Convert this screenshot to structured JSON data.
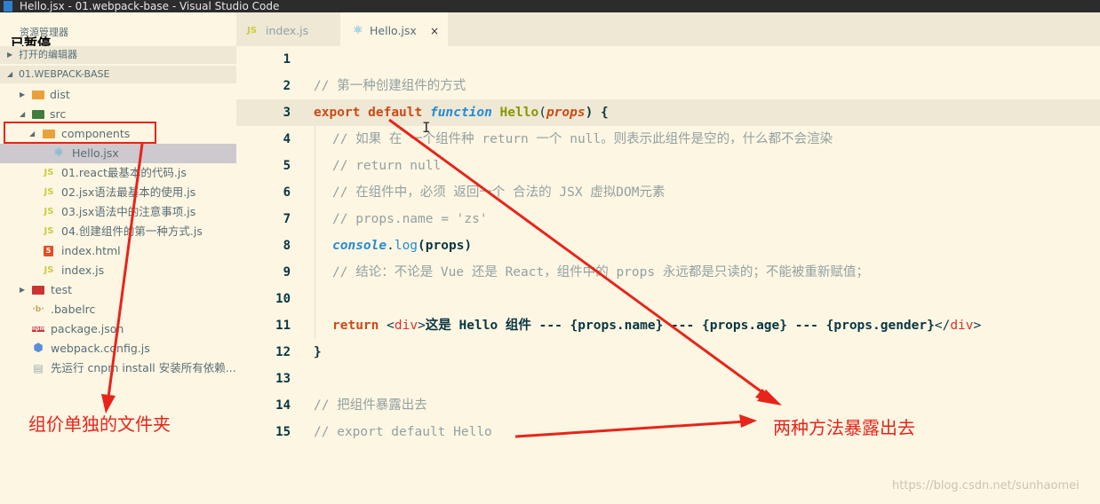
{
  "window": {
    "title": "Hello.jsx - 01.webpack-base - Visual Studio Code"
  },
  "sidebar": {
    "header": "资源管理器",
    "paused_label": "已暂停",
    "open_editors": "打开的编辑器",
    "project": "01.WEBPACK-BASE",
    "tree": [
      {
        "name": "dist",
        "icon": "folder-icon",
        "twisty": "collapsed"
      },
      {
        "name": "src",
        "icon": "folder-green-icon",
        "twisty": "expanded"
      },
      {
        "name": "components",
        "icon": "folder-open-icon",
        "twisty": "expanded"
      },
      {
        "name": "Hello.jsx",
        "icon": "react-icon"
      },
      {
        "name": "01.react最基本的代码.js",
        "icon": "js-icon"
      },
      {
        "name": "02.jsx语法最基本的使用.js",
        "icon": "js-icon"
      },
      {
        "name": "03.jsx语法中的注意事项.js",
        "icon": "js-icon"
      },
      {
        "name": "04.创建组件的第一种方式.js",
        "icon": "js-icon"
      },
      {
        "name": "index.html",
        "icon": "html-icon"
      },
      {
        "name": "index.js",
        "icon": "js-icon"
      },
      {
        "name": "test",
        "icon": "folder-red-icon",
        "twisty": "collapsed"
      },
      {
        "name": ".babelrc",
        "icon": "babel-icon"
      },
      {
        "name": "package.json",
        "icon": "npm-icon"
      },
      {
        "name": "webpack.config.js",
        "icon": "webpack-icon"
      },
      {
        "name": "先运行 cnpm install 安装所有依赖...",
        "icon": "doc-icon"
      }
    ]
  },
  "tabs": [
    {
      "label": "index.js",
      "icon": "js-icon"
    },
    {
      "label": "Hello.jsx",
      "icon": "react-icon",
      "close": "×"
    }
  ],
  "icons": {
    "js": "JS",
    "html": "5",
    "react": "⚛",
    "folder": "▬",
    "babel": "·b·",
    "npm": "npm",
    "webpack": "⬢",
    "doc": "▤",
    "close": "×"
  },
  "editor": {
    "line_numbers": [
      "1",
      "2",
      "3",
      "4",
      "5",
      "6",
      "7",
      "8",
      "9",
      "10",
      "11",
      "12",
      "13",
      "14",
      "15"
    ],
    "comment_l2": "// 第一种创建组件的方式",
    "l3": {
      "export": "export",
      "default": "default",
      "function": "function",
      "name": "Hello",
      "paren_open": "(",
      "param": "props",
      "rest": ") {"
    },
    "comment_l4": "// 如果 在 一个组件种 return 一个 null。则表示此组件是空的，什么都不会渲染",
    "comment_l5": "// return null",
    "comment_l6": "// 在组件中，必须 返回一个 合法的 JSX 虚拟DOM元素",
    "comment_l7": "// props.name = 'zs'",
    "l8": {
      "obj": "console",
      "dot": ".",
      "meth": "log",
      "args": "(props)"
    },
    "comment_l9": "// 结论：不论是 Vue 还是 React，组件中的 props 永远都是只读的；不能被重新赋值；",
    "l11": {
      "return": "return",
      "lt": " <",
      "tag": "div",
      "gt": ">",
      "text": "这是 Hello 组件 --- {props.name} --- {props.age} --- {props.gender}",
      "close_lt": "</",
      "close_tag": "div",
      "close_gt": ">"
    },
    "l12": "}",
    "comment_l14": "// 把组件暴露出去",
    "comment_l15": "// export default Hello"
  },
  "annotations": {
    "folder_note": "组价单独的文件夹",
    "export_note": "两种方法暴露出去",
    "annotation_color": "#e8241a"
  },
  "watermark": "https://blog.csdn.net/sunhaomei"
}
